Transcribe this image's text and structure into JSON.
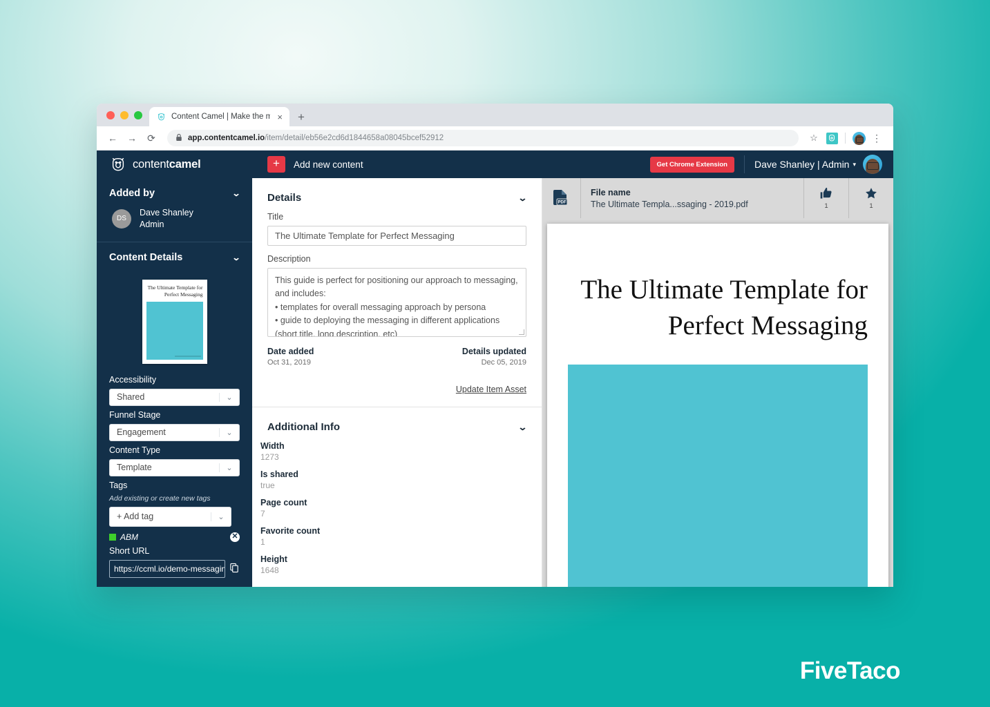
{
  "browser": {
    "tab": {
      "title": "Content Camel | Make the mos",
      "favicon_icon": "camel-favicon",
      "close_icon": "×"
    },
    "new_tab_icon": "+",
    "back_icon": "←",
    "forward_icon": "→",
    "reload_icon": "⟳",
    "lock_icon": "🔒",
    "url_host": "app.contentcamel.io",
    "url_path": "/item/detail/eb56e2cd6d1844658a08045bcef52912",
    "bookmark_icon": "☆",
    "extension_icon": "camel-extension-icon",
    "profile_icon": "profile-avatar",
    "menu_icon": "⋮"
  },
  "app_header": {
    "brand_light": "content",
    "brand_bold": "camel",
    "plus_label": "+",
    "add_new_content": "Add new content",
    "chrome_extension_btn": "Get Chrome Extension",
    "user_label": "Dave Shanley | Admin",
    "caret": "▾"
  },
  "sidebar": {
    "added_by": {
      "heading": "Added by",
      "initials": "DS",
      "name": "Dave Shanley",
      "role": "Admin"
    },
    "content_details_heading": "Content Details",
    "thumbnail_title": "The Ultimate Template for Perfect Messaging",
    "accessibility_label": "Accessibility",
    "accessibility_value": "Shared",
    "funnel_stage_label": "Funnel Stage",
    "funnel_stage_value": "Engagement",
    "content_type_label": "Content Type",
    "content_type_value": "Template",
    "tags_label": "Tags",
    "tags_hint": "Add existing or create new tags",
    "add_tag_placeholder": "+ Add tag",
    "tag_name": "ABM",
    "tag_color": "#3ecf2b",
    "tag_remove_icon": "✕",
    "short_url_label": "Short URL",
    "short_url_value": "https://ccml.io/demo-messaging",
    "copy_icon": "⧉",
    "chevron": "⌄"
  },
  "details": {
    "heading": "Details",
    "title_label": "Title",
    "title_value": "The Ultimate Template for Perfect Messaging",
    "description_label": "Description",
    "description_value": "This guide is perfect for positioning our approach to messaging, and includes:\n• templates for overall messaging approach by persona\n• guide to deploying the messaging in different applications (short title, long description, etc)",
    "date_added_label": "Date added",
    "date_added_value": "Oct 31, 2019",
    "details_updated_label": "Details updated",
    "details_updated_value": "Dec 05, 2019",
    "update_item_asset": "Update Item Asset",
    "chevron": "⌄"
  },
  "additional_info": {
    "heading": "Additional Info",
    "chevron": "⌄",
    "items": [
      {
        "key": "Width",
        "value": "1273"
      },
      {
        "key": "Is shared",
        "value": "true"
      },
      {
        "key": "Page count",
        "value": "7"
      },
      {
        "key": "Favorite count",
        "value": "1"
      },
      {
        "key": "Height",
        "value": "1648"
      }
    ]
  },
  "preview": {
    "file_icon": "pdf-file-icon",
    "file_name_label": "File name",
    "file_name_value": "The Ultimate Templa...ssaging - 2019.pdf",
    "like_icon": "thumbs-up-icon",
    "like_count": "1",
    "favorite_icon": "star-icon",
    "favorite_count": "1",
    "doc_title": "The Ultimate Template for Perfect Messaging",
    "doc_accent_color": "#50c3d2"
  },
  "watermark": "FiveTaco",
  "colors": {
    "brand_navy": "#133049",
    "accent_red": "#e63946",
    "teal": "#0ab3aa"
  }
}
